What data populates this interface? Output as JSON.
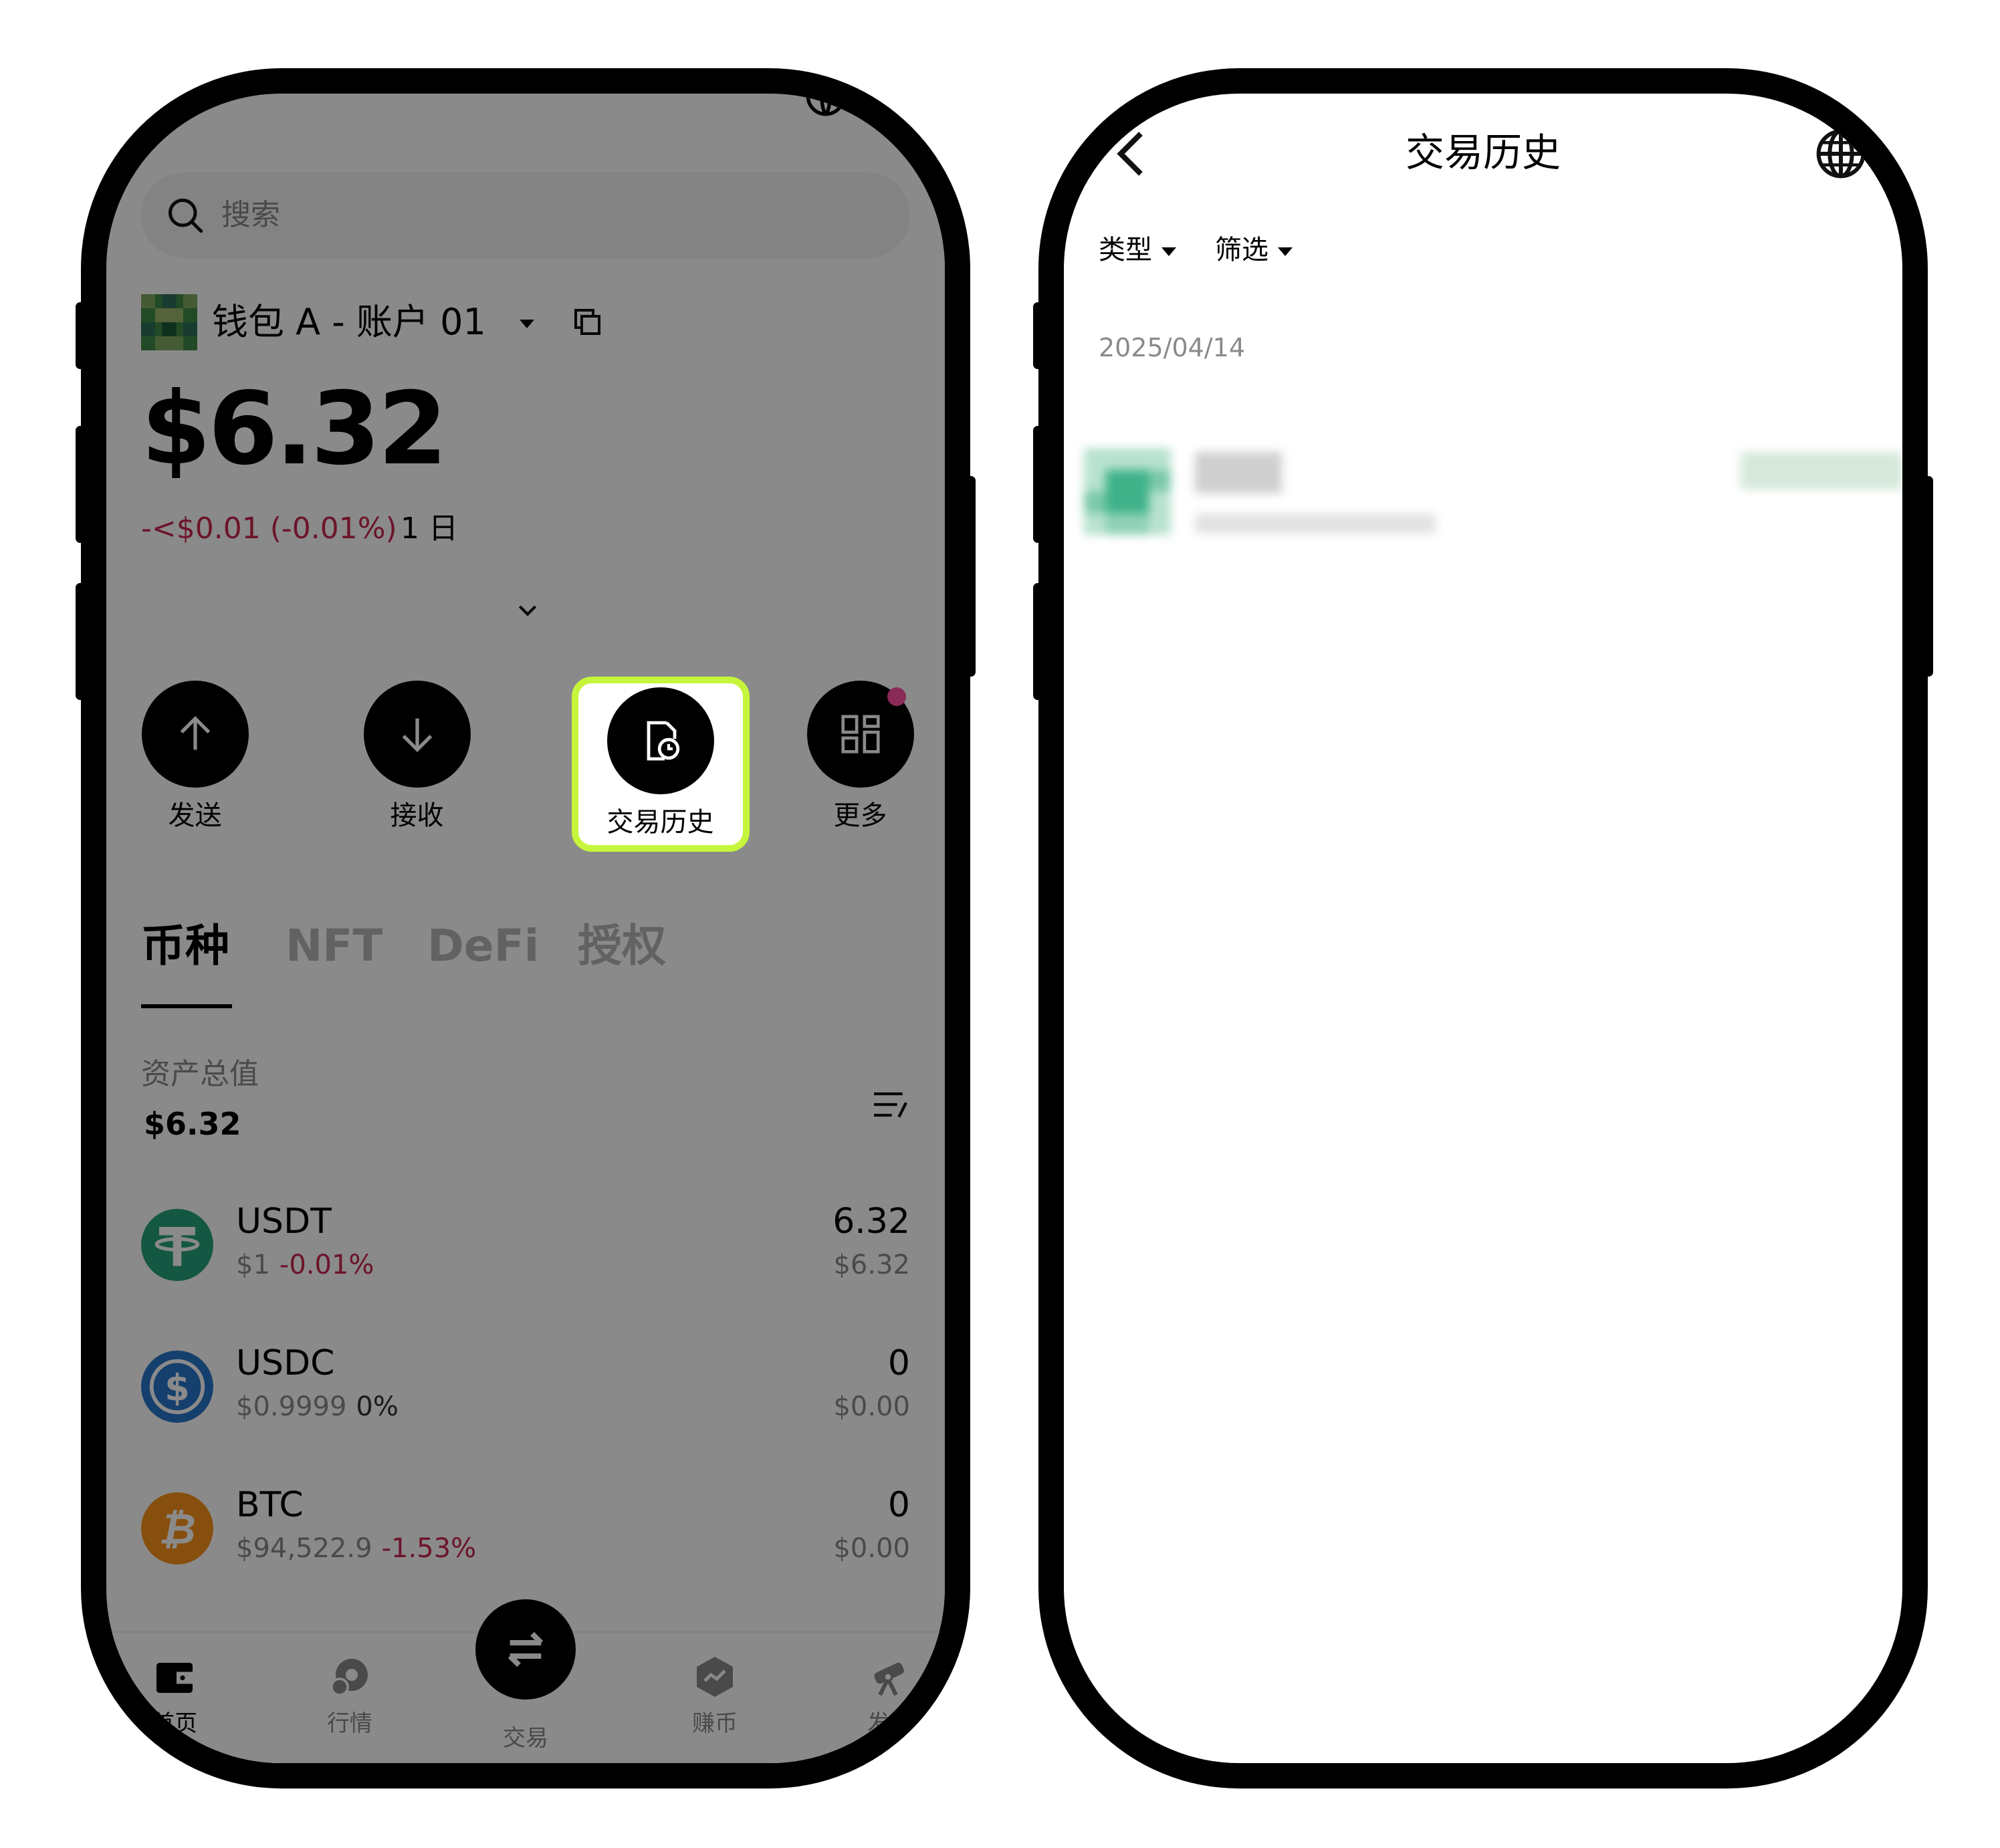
{
  "left": {
    "search": {
      "placeholder": "搜索"
    },
    "wallet": {
      "name": "钱包 A - 账户 01",
      "balance": "$6.32",
      "change": "-<$0.01 (-0.01%)",
      "period": "1 日"
    },
    "actions": [
      {
        "label": "发送",
        "icon": "arrow-up-icon"
      },
      {
        "label": "接收",
        "icon": "arrow-down-icon"
      },
      {
        "label": "交易历史",
        "icon": "history-icon"
      },
      {
        "label": "更多",
        "icon": "grid-icon"
      }
    ],
    "tabs": [
      "币种",
      "NFT",
      "DeFi",
      "授权"
    ],
    "assets": {
      "label": "资产总值",
      "value": "$6.32"
    },
    "coins": [
      {
        "symbol": "USDT",
        "price": "$1",
        "change": "-0.01%",
        "amount": "6.32",
        "usd": "$6.32"
      },
      {
        "symbol": "USDC",
        "price": "$0.9999",
        "change": "0%",
        "amount": "0",
        "usd": "$0.00"
      },
      {
        "symbol": "BTC",
        "price": "$94,522.9",
        "change": "-1.53%",
        "amount": "0",
        "usd": "$0.00"
      }
    ],
    "nav": [
      "首页",
      "行情",
      "交易",
      "赚币",
      "发现"
    ]
  },
  "right": {
    "title": "交易历史",
    "filters": [
      "类型",
      "筛选"
    ],
    "date": "2025/04/14"
  },
  "colors": {
    "highlight": "#c6f53c",
    "negative": "#c7264f",
    "usdt": "#26a17b",
    "usdc": "#2775ca",
    "btc": "#f7931a"
  }
}
